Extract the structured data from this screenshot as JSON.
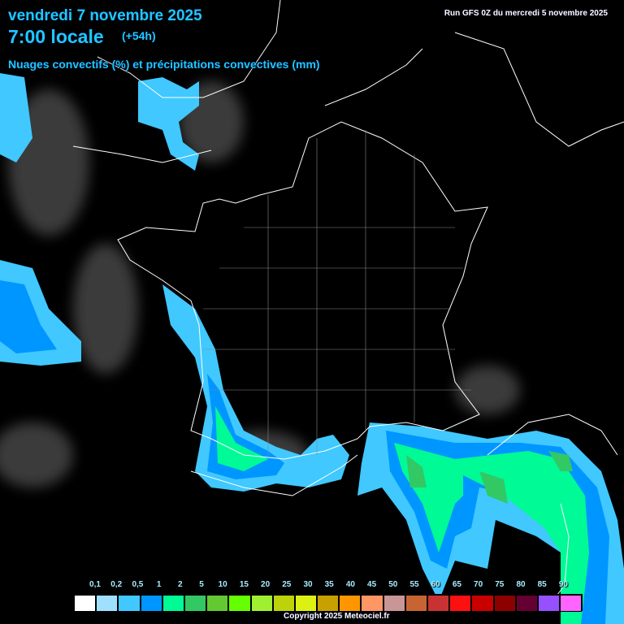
{
  "header": {
    "date": "vendredi 7 novembre 2025",
    "hour": "7:00 locale",
    "lead": "(+54h)",
    "parameter": "Nuages convectifs (%) et précipitations convectives (mm)",
    "run": "Run GFS 0Z du mercredi 5 novembre 2025"
  },
  "legend": {
    "labels": [
      "0,1",
      "0,2",
      "0,5",
      "1",
      "2",
      "5",
      "10",
      "15",
      "20",
      "25",
      "30",
      "35",
      "40",
      "45",
      "50",
      "55",
      "60",
      "65",
      "70",
      "75",
      "80",
      "85",
      "90"
    ],
    "colors": [
      "#ffffff",
      "#a0e0ff",
      "#40c8ff",
      "#0096ff",
      "#00fa96",
      "#32c864",
      "#64c832",
      "#64ff00",
      "#a0f032",
      "#bed20a",
      "#dcf014",
      "#c8a000",
      "#ff9600",
      "#ff9664",
      "#c89696",
      "#c86432",
      "#c83232",
      "#ff1010",
      "#c80000",
      "#8c0000",
      "#640032",
      "#9650ff",
      "#ff64ff"
    ]
  },
  "footer": {
    "copyright": "Copyright 2025 Meteociel.fr"
  }
}
